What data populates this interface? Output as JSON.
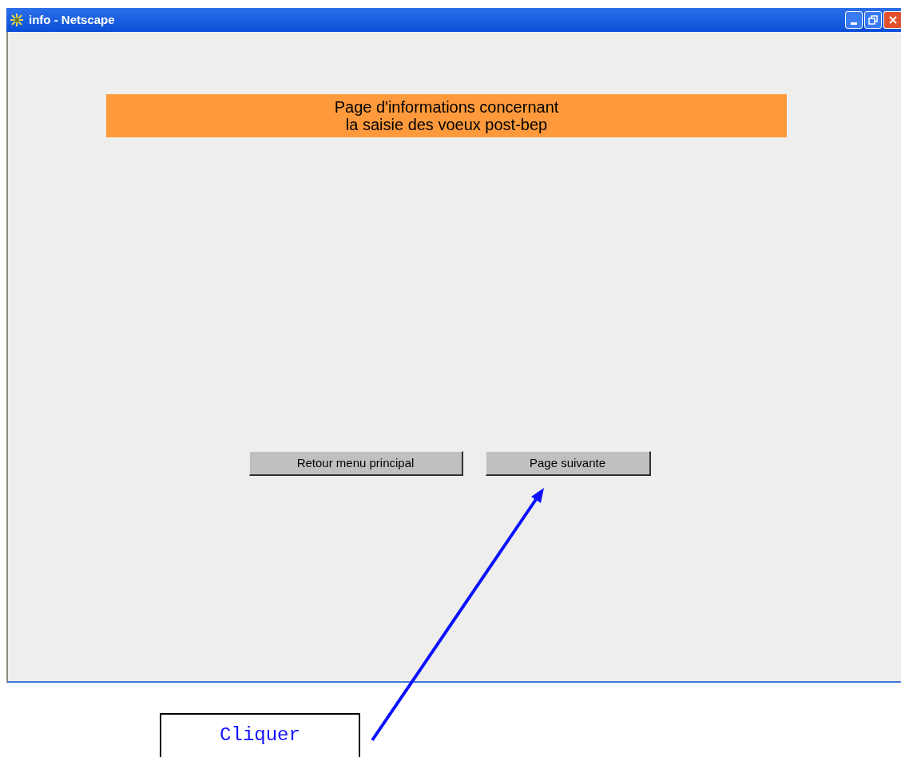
{
  "window": {
    "title": "info - Netscape"
  },
  "banner": {
    "lines": [
      "Page d'informations concernant",
      "la saisie des voeux post-bep"
    ]
  },
  "buttons": [
    "Retour menu principal",
    "Page suivante"
  ],
  "callout": {
    "text": "Cliquer"
  }
}
